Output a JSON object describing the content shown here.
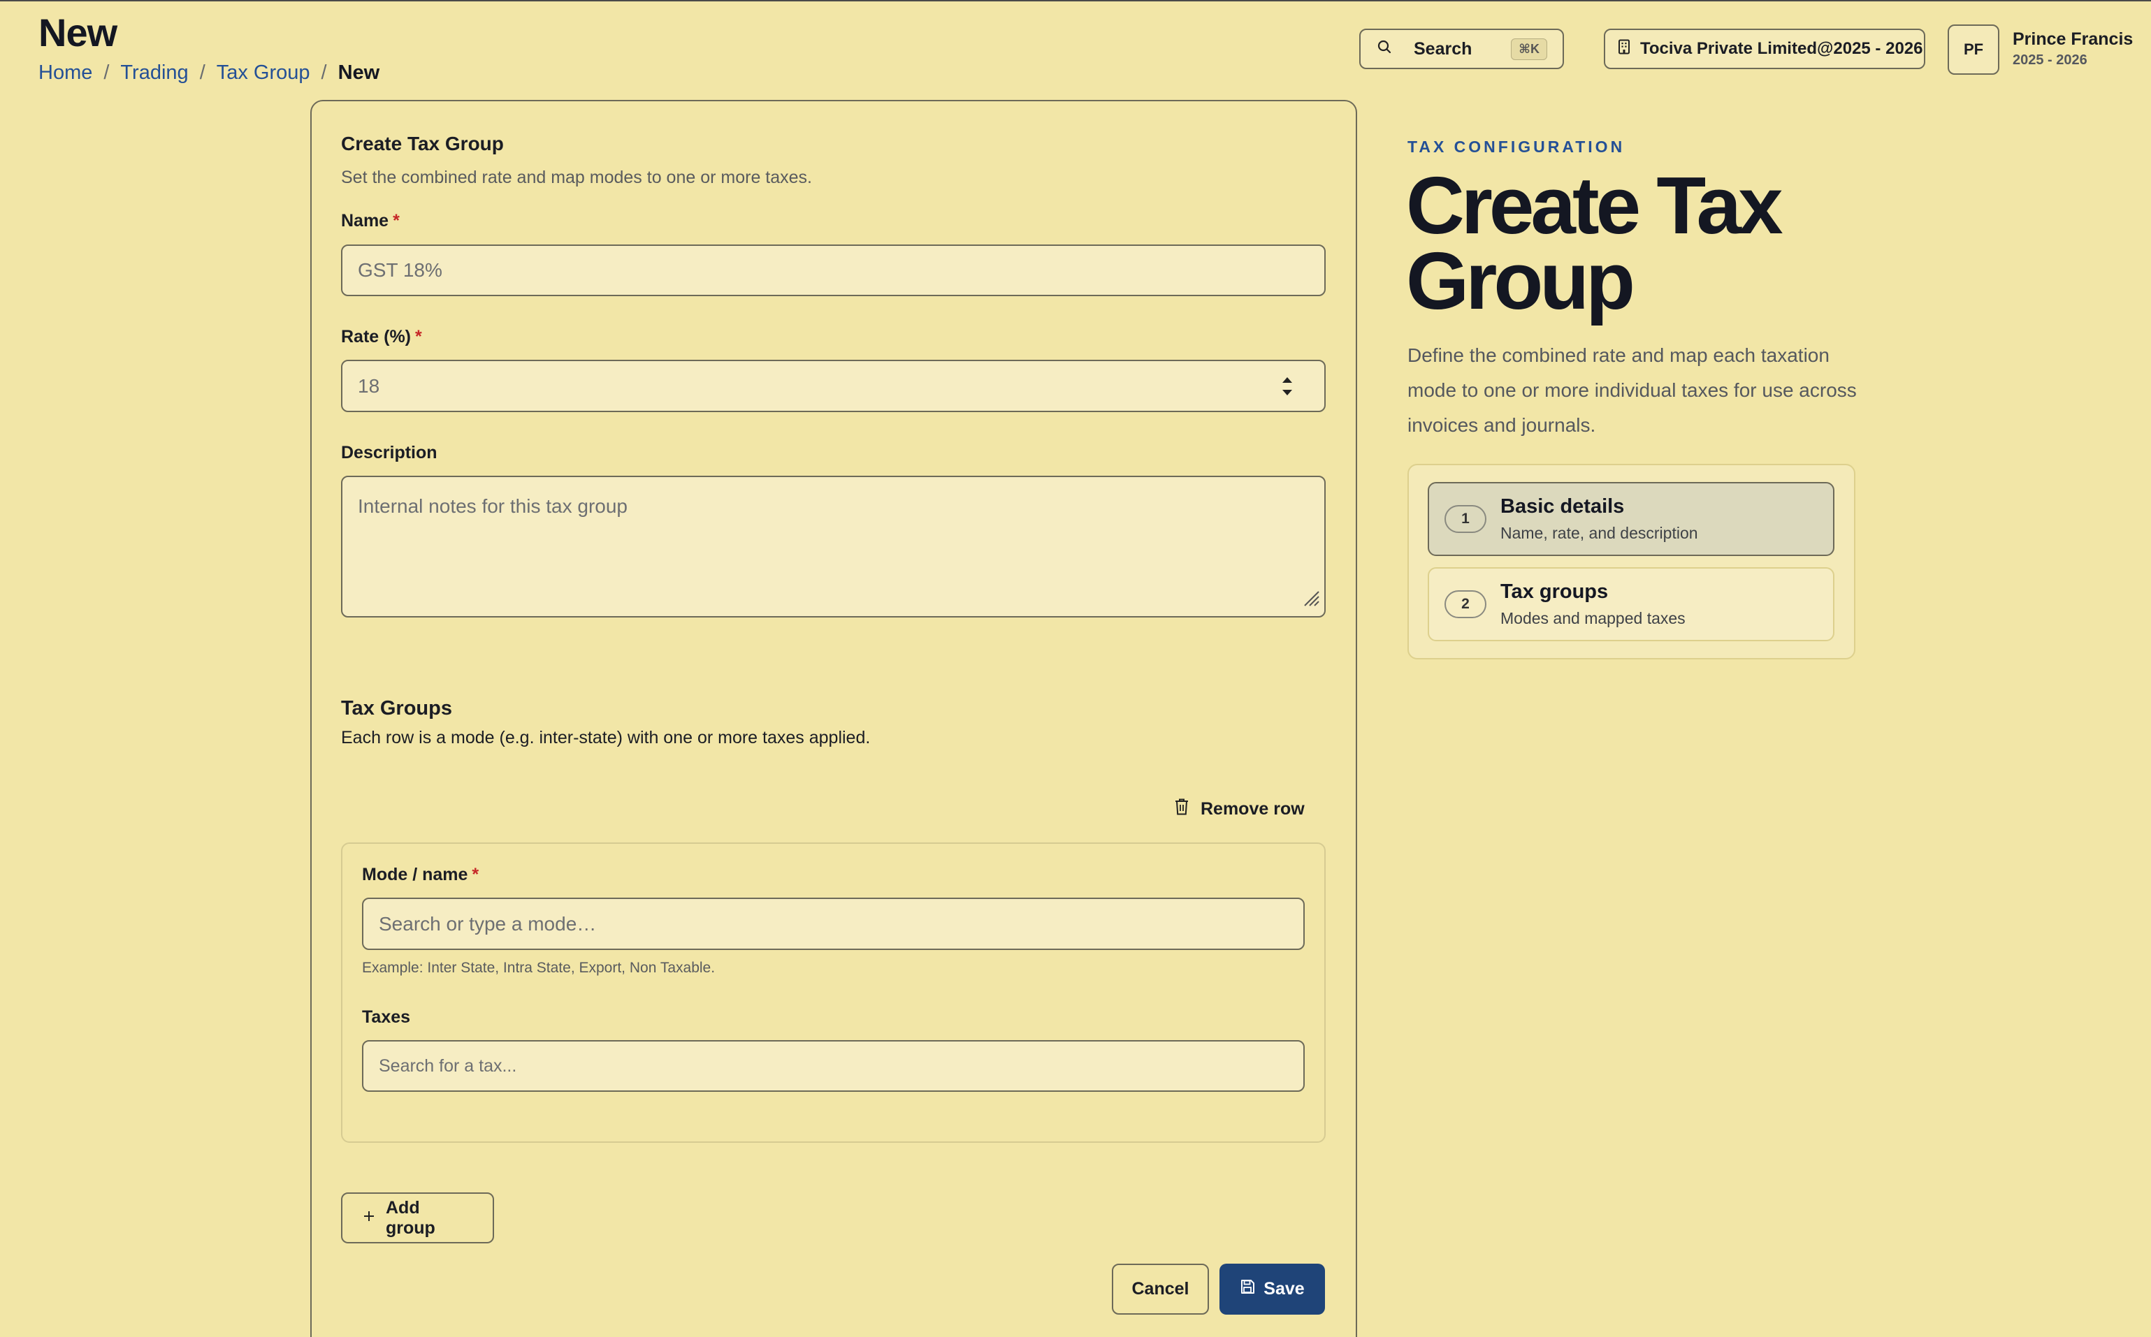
{
  "header": {
    "title": "New",
    "breadcrumb": [
      "Home",
      "Trading",
      "Tax Group"
    ],
    "breadcrumb_current": "New",
    "search_label": "Search",
    "search_shortcut": "⌘K",
    "company": "Tociva Private Limited@2025 - 2026",
    "user_initials": "PF",
    "user_name": "Prince Francis",
    "user_year": "2025 - 2026"
  },
  "form": {
    "title": "Create Tax Group",
    "subtitle": "Set the combined rate and map modes to one or more taxes.",
    "name_label": "Name",
    "name_placeholder": "GST 18%",
    "rate_label": "Rate (%)",
    "rate_value": "18",
    "description_label": "Description",
    "description_placeholder": "Internal notes for this tax group",
    "required_mark": "*"
  },
  "tax_groups": {
    "title": "Tax Groups",
    "subtitle": "Each row is a mode (e.g. inter-state) with one or more taxes applied.",
    "remove_row_label": "Remove row",
    "mode_label": "Mode / name",
    "mode_placeholder": "Search or type a mode…",
    "mode_hint": "Example: Inter State, Intra State, Export, Non Taxable.",
    "taxes_label": "Taxes",
    "taxes_placeholder": "Search for a tax...",
    "add_group_label": "Add group"
  },
  "actions": {
    "cancel_label": "Cancel",
    "save_label": "Save"
  },
  "side_panel": {
    "eyebrow": "TAX CONFIGURATION",
    "title": "Create Tax Group",
    "description": "Define the combined rate and map each taxation mode to one or more individual taxes for use across invoices and journals.",
    "steps": [
      {
        "number": "1",
        "title": "Basic details",
        "subtitle": "Name, rate, and description",
        "active": true
      },
      {
        "number": "2",
        "title": "Tax groups",
        "subtitle": "Modes and mapped taxes",
        "active": false
      }
    ]
  },
  "colors": {
    "background": "#f2e6a7",
    "accent": "#1f4478",
    "link": "#245096",
    "required": "#c62828"
  }
}
